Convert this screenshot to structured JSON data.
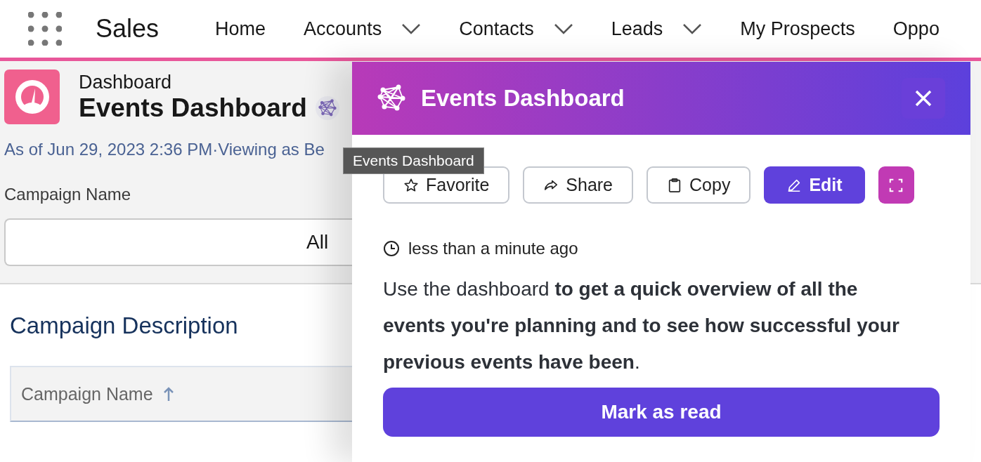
{
  "app": {
    "name": "Sales"
  },
  "nav": [
    {
      "label": "Home",
      "menu": false
    },
    {
      "label": "Accounts",
      "menu": true
    },
    {
      "label": "Contacts",
      "menu": true
    },
    {
      "label": "Leads",
      "menu": true
    },
    {
      "label": "My Prospects",
      "menu": false
    },
    {
      "label": "Oppo",
      "menu": false
    }
  ],
  "header": {
    "object_type": "Dashboard",
    "title": "Events Dashboard",
    "subtitle": "As of Jun 29, 2023 2:36 PM·Viewing as Be"
  },
  "filter": {
    "label": "Campaign Name",
    "value": "All"
  },
  "section": {
    "title": "Campaign Description",
    "columns": [
      {
        "label": "Campaign Name",
        "sorted_ascending": true
      }
    ]
  },
  "tooltip": "Events Dashboard",
  "panel": {
    "title": "Events Dashboard",
    "actions": [
      {
        "kind": "favorite",
        "label": "Favorite"
      },
      {
        "kind": "share",
        "label": "Share"
      },
      {
        "kind": "copy",
        "label": "Copy"
      },
      {
        "kind": "edit",
        "label": "Edit"
      },
      {
        "kind": "expand"
      }
    ],
    "time": "less than a minute ago",
    "body": "Use the dashboard **to get a quick overview of all the events you're planning and to see how successful your previous events have been**.",
    "button": "Mark as read"
  }
}
